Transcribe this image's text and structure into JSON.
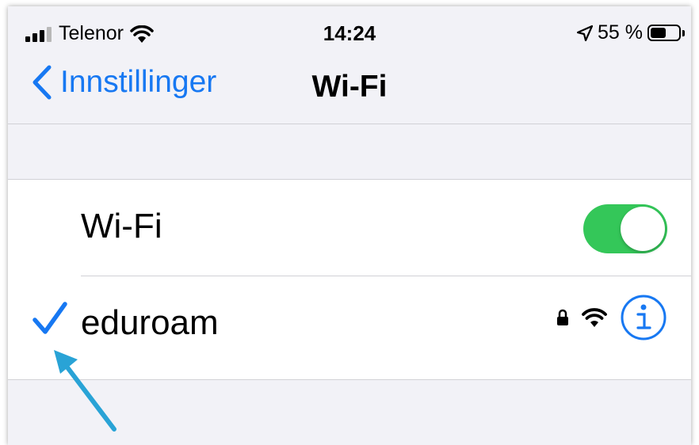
{
  "status_bar": {
    "carrier": "Telenor",
    "time": "14:24",
    "battery_text": "55 %",
    "battery_level": 0.55,
    "icons": [
      "signal-icon",
      "wifi-icon",
      "location-icon",
      "battery-icon"
    ]
  },
  "nav": {
    "back_label": "Innstillinger",
    "title": "Wi-Fi"
  },
  "wifi_row": {
    "label": "Wi-Fi",
    "toggle_on": true
  },
  "network_row": {
    "name": "eduroam",
    "selected": true,
    "secured": true,
    "icons": [
      "checkmark-icon",
      "lock-icon",
      "wifi-signal-icon",
      "info-icon"
    ]
  },
  "colors": {
    "accent": "#1778f2",
    "toggle_on": "#34c759",
    "background": "#f2f2f7",
    "annotation_arrow": "#29a3d6"
  }
}
